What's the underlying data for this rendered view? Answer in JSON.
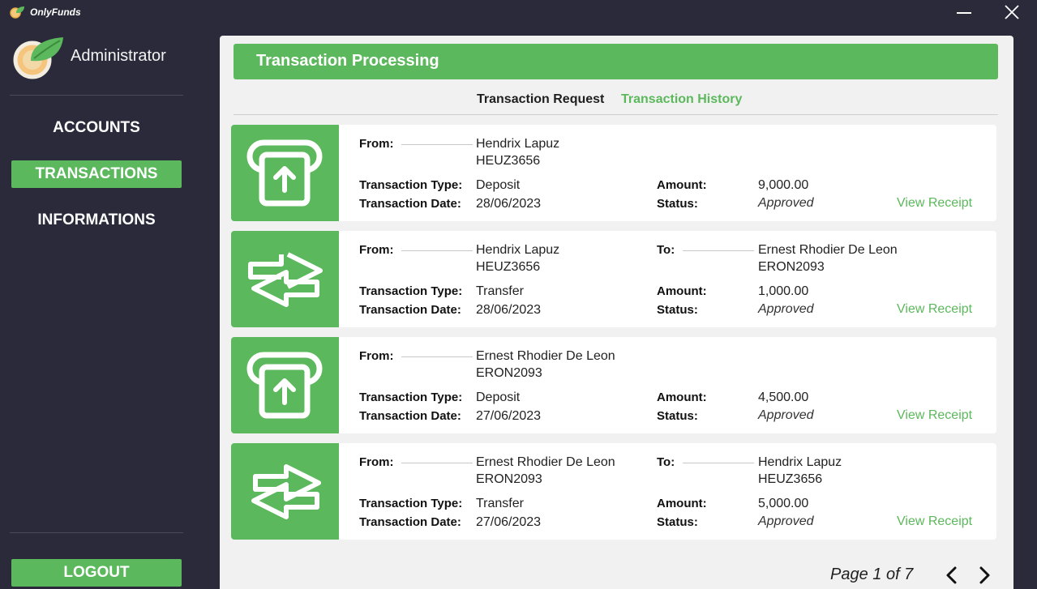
{
  "app": {
    "title": "OnlyFunds"
  },
  "sidebar": {
    "user": "Administrator",
    "nav": [
      {
        "label": "ACCOUNTS"
      },
      {
        "label": "TRANSACTIONS"
      },
      {
        "label": "INFORMATIONS"
      }
    ],
    "logout": "LOGOUT"
  },
  "main": {
    "title": "Transaction Processing",
    "tabs": [
      {
        "label": "Transaction Request"
      },
      {
        "label": "Transaction History"
      }
    ],
    "labels": {
      "from": "From:",
      "to": "To:",
      "type": "Transaction Type:",
      "date": "Transaction Date:",
      "amount": "Amount:",
      "status": "Status:",
      "receipt": "View Receipt"
    },
    "transactions": [
      {
        "icon": "deposit-icon",
        "from_name": "Hendrix Lapuz",
        "from_id": "HEUZ3656",
        "to_name": "",
        "to_id": "",
        "type": "Deposit",
        "date": "28/06/2023",
        "amount": "9,000.00",
        "status": "Approved"
      },
      {
        "icon": "transfer-icon",
        "from_name": "Hendrix Lapuz",
        "from_id": "HEUZ3656",
        "to_name": "Ernest Rhodier De Leon",
        "to_id": "ERON2093",
        "type": "Transfer",
        "date": "28/06/2023",
        "amount": "1,000.00",
        "status": "Approved"
      },
      {
        "icon": "deposit-icon",
        "from_name": "Ernest Rhodier De Leon",
        "from_id": "ERON2093",
        "to_name": "",
        "to_id": "",
        "type": "Deposit",
        "date": "27/06/2023",
        "amount": "4,500.00",
        "status": "Approved"
      },
      {
        "icon": "transfer-icon",
        "from_name": "Ernest Rhodier De Leon",
        "from_id": "ERON2093",
        "to_name": "Hendrix Lapuz",
        "to_id": "HEUZ3656",
        "type": "Transfer",
        "date": "27/06/2023",
        "amount": "5,000.00",
        "status": "Approved"
      }
    ],
    "pager": {
      "text": "Page 1 of 7"
    }
  },
  "colors": {
    "accent": "#5cb85c",
    "sidebar": "#2b2a3a",
    "panel": "#f1f1f1"
  }
}
